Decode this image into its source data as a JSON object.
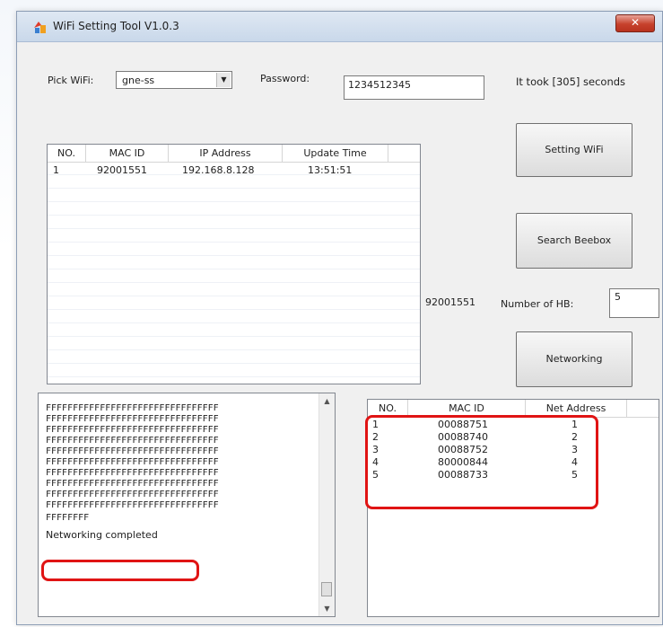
{
  "window": {
    "title": "WiFi Setting Tool V1.0.3",
    "close_glyph": "✕"
  },
  "wifi": {
    "pick_label": "Pick WiFi:",
    "selected": "gne-ss",
    "password_label": "Password:",
    "password_value": "1234512345",
    "elapsed_text": "It took [305] seconds"
  },
  "buttons": {
    "setting_wifi": "Setting WiFi",
    "search_beebox": "Search Beebox",
    "networking": "Networking"
  },
  "device_table": {
    "columns": [
      "NO.",
      "MAC ID",
      "IP Address",
      "Update Time"
    ],
    "rows": [
      {
        "no": "1",
        "mac": "92001551",
        "ip": "192.168.8.128",
        "time": "13:51:51"
      }
    ]
  },
  "hb": {
    "device_id": "92001551",
    "label": "Number of HB:",
    "value": "5"
  },
  "log": {
    "lines": [
      "FFFFFFFFFFFFFFFFFFFFFFFFFFFFFFFF",
      "FFFFFFFFFFFFFFFFFFFFFFFFFFFFFFFF",
      "FFFFFFFFFFFFFFFFFFFFFFFFFFFFFFFF",
      "FFFFFFFFFFFFFFFFFFFFFFFFFFFFFFFF",
      "FFFFFFFFFFFFFFFFFFFFFFFFFFFFFFFF",
      "FFFFFFFFFFFFFFFFFFFFFFFFFFFFFFFF",
      "FFFFFFFFFFFFFFFFFFFFFFFFFFFFFFFF",
      "FFFFFFFFFFFFFFFFFFFFFFFFFFFFFFFF",
      "FFFFFFFFFFFFFFFFFFFFFFFFFFFFFFFF",
      "FFFFFFFFFFFFFFFFFFFFFFFFFFFFFFFF",
      "FFFFFFFF"
    ],
    "status": "Networking completed"
  },
  "net_table": {
    "columns": [
      "NO.",
      "MAC ID",
      "Net Address"
    ],
    "rows": [
      {
        "no": "1",
        "mac": "00088751",
        "addr": "1"
      },
      {
        "no": "2",
        "mac": "00088740",
        "addr": "2"
      },
      {
        "no": "3",
        "mac": "00088752",
        "addr": "3"
      },
      {
        "no": "4",
        "mac": "80000844",
        "addr": "4"
      },
      {
        "no": "5",
        "mac": "00088733",
        "addr": "5"
      }
    ]
  },
  "colors": {
    "highlight": "#e01414",
    "window_bg": "#f0f0f0"
  }
}
